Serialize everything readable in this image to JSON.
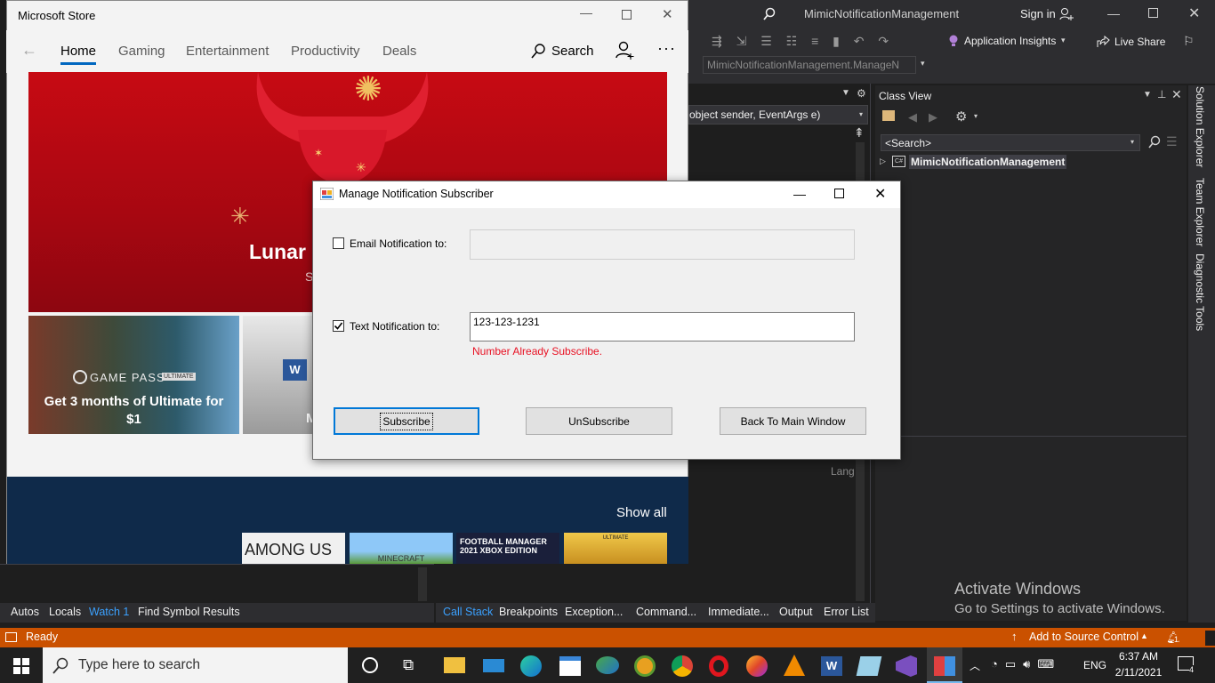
{
  "vs": {
    "window_title": "MimicNotificationManagement",
    "sign_in": "Sign in",
    "app_insights": "Application Insights",
    "live_share": "Live Share",
    "class_combo": "MimicNotificationManagement.ManageN",
    "method_combo": "object sender, EventArgs e)",
    "lang_label": "Lang",
    "class_view": {
      "title": "Class View",
      "search_placeholder": "<Search>",
      "node": "MimicNotificationManagement"
    },
    "side_tabs": [
      "Solution Explorer",
      "Team Explorer",
      "Diagnostic Tools"
    ],
    "bottom_tabs_left": [
      "Autos",
      "Locals",
      "Watch 1",
      "Find Symbol Results"
    ],
    "bottom_tabs_right": [
      "Call Stack",
      "Breakpoints",
      "Exception...",
      "Command...",
      "Immediate...",
      "Output",
      "Error List"
    ],
    "status_ready": "Ready",
    "status_source": "Add to Source Control",
    "status_badge": "1"
  },
  "watermark": {
    "line1": "Activate Windows",
    "line2": "Go to Settings to activate Windows."
  },
  "store": {
    "title": "Microsoft Store",
    "nav": [
      "Home",
      "Gaming",
      "Entertainment",
      "Productivity",
      "Deals"
    ],
    "active_nav": "Home",
    "search": "Search",
    "hero_title": "Lunar I",
    "hero_sub": "S",
    "tile1_brand": "GAME PASS",
    "tile1_brand_badge": "ULTIMATE",
    "tile1_text": "Get 3 months of Ultimate for $1",
    "tile2_text": "M",
    "show_all": "Show all",
    "games": [
      "AMONG US",
      "MINECRAFT",
      "FOOTBALL MANAGER 2021 XBOX EDITION",
      "ULTIMATE"
    ]
  },
  "dialog": {
    "title": "Manage Notification Subscriber",
    "email_label": "Email Notification to:",
    "email_checked": false,
    "email_value": "",
    "text_label": "Text Notification to:",
    "text_checked": true,
    "text_value": "123-123-1231",
    "error": "Number Already Subscribe.",
    "btn_subscribe": "Subscribe",
    "btn_unsubscribe": "UnSubscribe",
    "btn_back": "Back To Main Window"
  },
  "taskbar": {
    "search_placeholder": "Type here to search",
    "lang": "ENG",
    "time": "6:37 AM",
    "date": "2/11/2021",
    "notif_count": "4"
  }
}
